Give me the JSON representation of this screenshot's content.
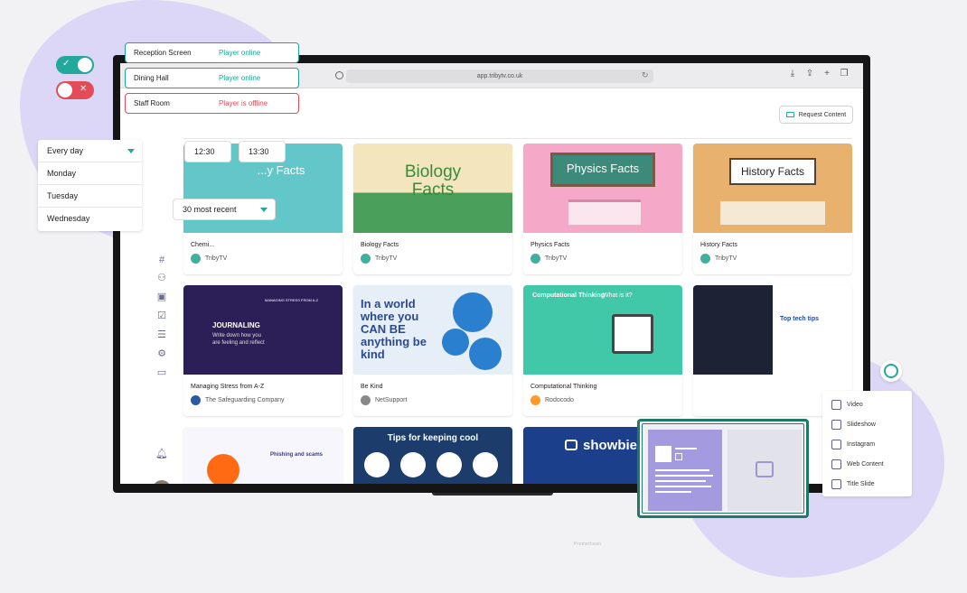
{
  "browser": {
    "url": "app.tribytv.co.uk"
  },
  "header": {
    "request_label": "Request Content"
  },
  "cards": [
    {
      "title": "Chemi...",
      "author": "TribyTV",
      "thumb_text": "...y Facts",
      "bg": "#63c7c9"
    },
    {
      "title": "Biology Facts",
      "author": "TribyTV",
      "thumb_text": "Biology Facts",
      "bg": "#e8d7a0"
    },
    {
      "title": "Physics Facts",
      "author": "TribyTV",
      "thumb_text": "Physics Facts",
      "bg": "#f6a8c8"
    },
    {
      "title": "History Facts",
      "author": "TribyTV",
      "thumb_text": "History Facts",
      "bg": "#e9b16e"
    },
    {
      "title": "Managing Stress from A-Z",
      "author": "The Safeguarding Company",
      "thumb_text": "JOURNALING",
      "thumb_sub": "MANAGING STRESS FROM A-Z",
      "thumb_body": "Write down how you are feeling and reflect",
      "bg": "#2c1f57"
    },
    {
      "title": "Be Kind",
      "author": "NetSupport",
      "thumb_text": "In a world where you CAN BE anything be kind",
      "bg": "#e6eef8"
    },
    {
      "title": "Computational Thinking",
      "author": "Rodocodo",
      "thumb_text": "Computational Thinking",
      "thumb_sub": "What is it?",
      "bg": "#41c8a8"
    },
    {
      "title": "",
      "author": "",
      "thumb_text": "Top tech tips",
      "bg": "#1e2235"
    },
    {
      "title": "",
      "author": "",
      "thumb_text": "Phishing and scams",
      "bg": "#f7f6fc"
    },
    {
      "title": "",
      "author": "",
      "thumb_text": "Tips for keeping cool",
      "bg": "#1c3d6b"
    },
    {
      "title": "",
      "author": "",
      "thumb_text": "showbie",
      "bg": "#1b3f8a"
    }
  ],
  "toggles": [
    {
      "state": "on",
      "color": "#23a89c",
      "mark": "✓"
    },
    {
      "state": "off",
      "color": "#e24c58",
      "mark": "✕"
    }
  ],
  "statuses": [
    {
      "name": "Reception Screen",
      "status": "Player online",
      "color": "#1ea392"
    },
    {
      "name": "Dining Hall",
      "status": "Player online",
      "color": "#1ea392"
    },
    {
      "name": "Staff Room",
      "status": "Player is offline",
      "color": "#e24c58"
    }
  ],
  "schedule": {
    "days": [
      "Every day",
      "Monday",
      "Tuesday",
      "Wednesday"
    ],
    "start": "12:30",
    "end": "13:30",
    "recent": "30 most recent"
  },
  "add_menu": [
    "Video",
    "Slideshow",
    "Instagram",
    "Web Content",
    "Title Slide"
  ],
  "monitor_brand": "Promethean"
}
